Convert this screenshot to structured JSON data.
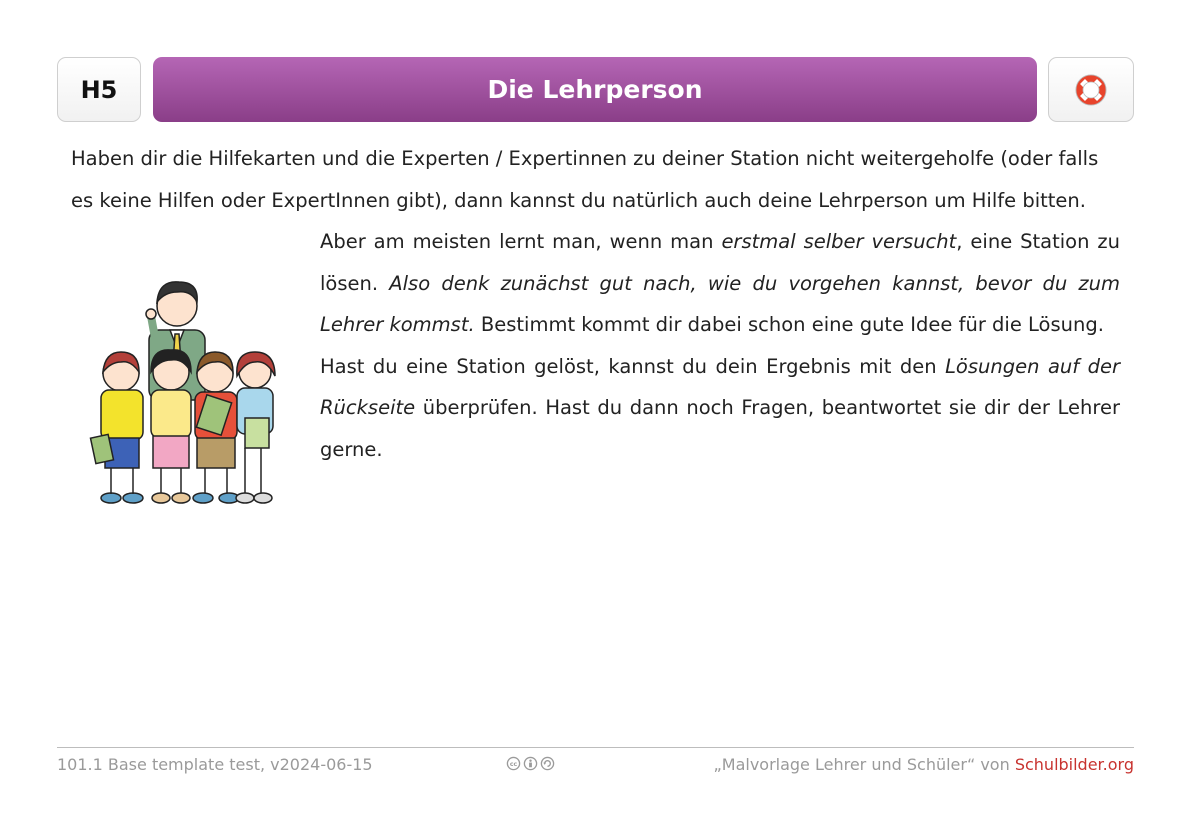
{
  "header": {
    "code": "H5",
    "title": "Die Lehrperson",
    "help_icon": "lifebuoy-icon"
  },
  "body": {
    "intro": "Haben dir die Hilfekarten und die Experten / Expertinnen zu deiner Station nicht weitergeholfe (oder falls es keine Hilfen oder ExpertInnen gibt), dann kannst du natürlich auch deine Lehrperson um Hilfe bitten.",
    "p1_a": "Aber am meisten lernt man, wenn man ",
    "p1_b_italic": "erstmal selber versucht",
    "p1_c": ", eine Station zu lösen. ",
    "p1_d_italic": "Also denk zunächst gut nach, wie du vorgehen kannst, bevor du zum Lehrer kommst.",
    "p1_e": " Bestimmt kommt dir dabei schon eine gute Idee für die Lösung.",
    "p2_a": "Hast du eine Station gelöst, kannst du dein Ergebnis mit den ",
    "p2_b_italic": "Lösungen auf der Rückseite",
    "p2_c": " überprüfen. Hast du dann noch Fragen, beantwortet sie dir der Lehrer gerne."
  },
  "footer": {
    "left": "101.1 Base template test, v2024-06-15",
    "license_icons": [
      "cc-icon",
      "by-icon",
      "sa-icon"
    ],
    "right_prefix": "„Malvorlage Lehrer und Schüler“ von ",
    "right_link": "Schulbilder.org"
  },
  "colors": {
    "title_bar_top": "#b566b5",
    "title_bar_bottom": "#8a3e88",
    "link": "#c8332f"
  }
}
